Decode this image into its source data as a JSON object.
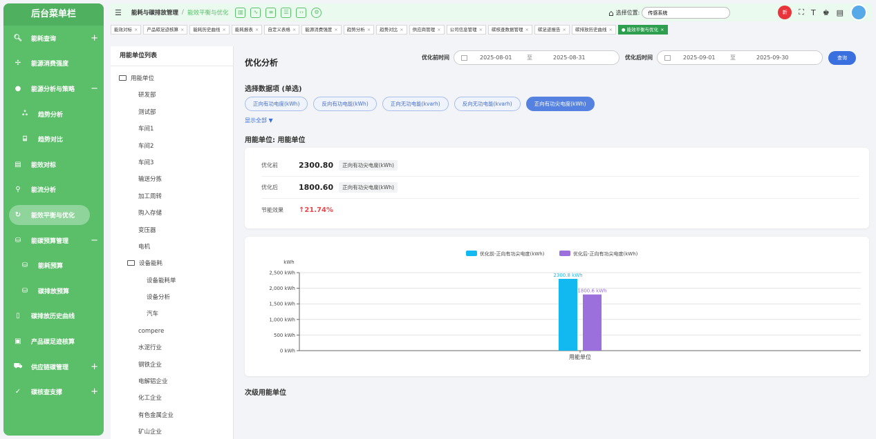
{
  "sidebar": {
    "title": "后台菜单栏",
    "items": [
      {
        "icon": "search-icon",
        "glyph": "🔍︎",
        "label": "能耗查询",
        "pm": "+"
      },
      {
        "icon": "move-icon",
        "glyph": "✢",
        "label": "能源消费强度",
        "pm": ""
      },
      {
        "icon": "bulb-icon",
        "glyph": "●",
        "label": "能源分析与策略",
        "pm": "−"
      },
      {
        "icon": "trend-icon",
        "glyph": "ஃ",
        "label": "趋势分析",
        "pm": ""
      },
      {
        "icon": "compare-icon",
        "glyph": "⌸",
        "label": "趋势对比",
        "pm": ""
      },
      {
        "icon": "benchmark-icon",
        "glyph": "▤",
        "label": "能效对标",
        "pm": ""
      },
      {
        "icon": "person-icon",
        "glyph": "⚲",
        "label": "能流分析",
        "pm": ""
      },
      {
        "icon": "refresh-icon",
        "glyph": "↻",
        "label": "能效平衡与优化",
        "pm": ""
      },
      {
        "icon": "database-icon",
        "glyph": "⛁",
        "label": "能碳预算管理",
        "pm": "−"
      },
      {
        "icon": "database-icon",
        "glyph": "⛁",
        "label": "能耗预算",
        "pm": ""
      },
      {
        "icon": "database-icon",
        "glyph": "⛁",
        "label": "碳排放预算",
        "pm": ""
      },
      {
        "icon": "book-icon",
        "glyph": "▯",
        "label": "碳排放历史曲线",
        "pm": ""
      },
      {
        "icon": "clipboard-icon",
        "glyph": "▣",
        "label": "产品碳足迹核算",
        "pm": ""
      },
      {
        "icon": "truck-icon",
        "glyph": "⛟",
        "label": "供应链碳管理",
        "pm": "+"
      },
      {
        "icon": "check-icon",
        "glyph": "✓",
        "label": "碳核查支撑",
        "pm": "+"
      }
    ]
  },
  "topbar": {
    "breadcrumb_parent": "能耗与碳排放管理",
    "breadcrumb_sep": "/",
    "breadcrumb_current": "能效平衡与优化",
    "location_label": "选择位置:",
    "location_value": "传感系统",
    "notif_badge": "新"
  },
  "tabs": [
    "能效对标",
    "产品碳足迹核算",
    "能耗历史曲线",
    "能耗报表",
    "自定义表格",
    "能源消费强度",
    "趋势分析",
    "趋势对比",
    "供应商管理",
    "公司信息管理",
    "碳核查数据管理",
    "碳足迹报告",
    "碳排放历史曲线",
    "能效平衡与优化"
  ],
  "tree": {
    "header": "用能单位列表",
    "nodes": [
      {
        "level": "l0",
        "folder": true,
        "label": "用能单位"
      },
      {
        "level": "l1",
        "label": "研发部"
      },
      {
        "level": "l1",
        "label": "测试部"
      },
      {
        "level": "l1",
        "label": "车间1"
      },
      {
        "level": "l1",
        "label": "车间2"
      },
      {
        "level": "l1",
        "label": "车间3"
      },
      {
        "level": "l1",
        "label": "输送分拣"
      },
      {
        "level": "l1",
        "label": "加工周转"
      },
      {
        "level": "l1",
        "label": "购入存储"
      },
      {
        "level": "l1",
        "label": "变压器"
      },
      {
        "level": "l1",
        "label": "电机"
      },
      {
        "level": "l1f",
        "folder": true,
        "label": "设备能耗"
      },
      {
        "level": "l2",
        "label": "设备能耗单"
      },
      {
        "level": "l2",
        "label": "设备分析"
      },
      {
        "level": "l2",
        "label": "汽车"
      },
      {
        "level": "l1",
        "label": "compere"
      },
      {
        "level": "l1",
        "label": "水泥行业"
      },
      {
        "level": "l1",
        "label": "钢铁企业"
      },
      {
        "level": "l1",
        "label": "电解铝企业"
      },
      {
        "level": "l1",
        "label": "化工企业"
      },
      {
        "level": "l1",
        "label": "有色金属企业"
      },
      {
        "level": "l1",
        "label": "矿山企业"
      }
    ]
  },
  "main": {
    "title": "优化分析",
    "before_label": "优化前时间",
    "before_start": "2025-08-01",
    "before_end": "2025-08-31",
    "after_label": "优化后时间",
    "after_start": "2025-09-01",
    "after_end": "2025-09-30",
    "range_sep": "至",
    "query_btn": "查询",
    "select_header": "选择数据项 (单选)",
    "chips": [
      "正向有功电度(kWh)",
      "反向有功电能(kWh)",
      "正向无功电能(kvarh)",
      "反向无功电能(kvarh)",
      "正向有功尖电度(kWh)"
    ],
    "selected_chip": 4,
    "show_all": "显示全部 ▼",
    "unit_header": "用能单位: 用能单位",
    "result": {
      "before_label": "优化前",
      "before_value": "2300.80",
      "before_unit": "正向有功尖电度(kWh)",
      "after_label": "优化后",
      "after_value": "1800.60",
      "after_unit": "正向有功尖电度(kWh)",
      "effect_label": "节能效果",
      "effect_value": "↑21.74%"
    },
    "sub_header": "次级用能单位"
  },
  "colors": {
    "sidebar": "#5bbf6a",
    "before_bar": "#12b8f0",
    "after_bar": "#9b6fdc",
    "accent": "#3a6fe0"
  },
  "chart_data": {
    "type": "bar",
    "categories": [
      "用能单位"
    ],
    "series": [
      {
        "name": "优化前-正向有功尖电度(kWh)",
        "values": [
          2300.8
        ],
        "labels": [
          "2300.8 kWh"
        ]
      },
      {
        "name": "优化后-正向有功尖电度(kWh)",
        "values": [
          1800.6
        ],
        "labels": [
          "1800.6 kWh"
        ]
      }
    ],
    "ylabel": "kWh",
    "yticks": [
      "0 kWh",
      "500 kWh",
      "1,000 kWh",
      "1,500 kWh",
      "2,000 kWh",
      "2,500 kWh"
    ],
    "ylim": [
      0,
      2500
    ],
    "legend": "top-center",
    "grid": true
  }
}
